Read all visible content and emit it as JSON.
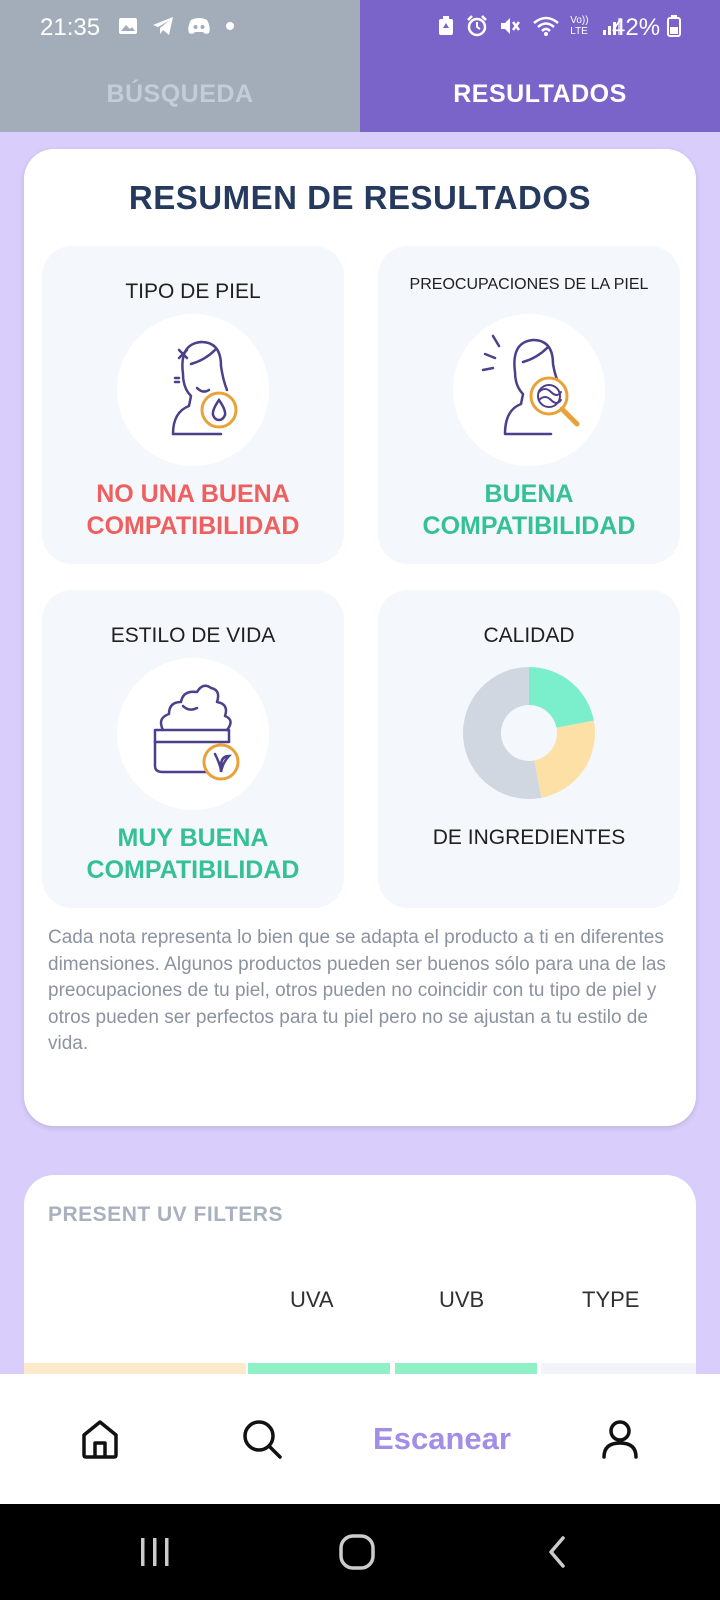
{
  "status_bar": {
    "time": "21:35",
    "battery": "42%",
    "left_icons": [
      "image-icon",
      "telegram-icon",
      "discord-icon",
      "dot-icon"
    ],
    "right_icons": [
      "battery-saver-icon",
      "alarm-icon",
      "mute-icon",
      "wifi-icon",
      "volte-icon",
      "signal-icon"
    ],
    "volte_label": "Vo)) LTE"
  },
  "tabs": [
    {
      "label": "BÚSQUEDA",
      "active": false
    },
    {
      "label": "RESULTADOS",
      "active": true
    }
  ],
  "summary": {
    "title": "RESUMEN DE RESULTADOS",
    "tiles": {
      "skin_type": {
        "title": "TIPO DE PIEL",
        "result_line1": "NO UNA BUENA",
        "result_line2": "COMPATIBILIDAD",
        "result_color": "#ee6060",
        "icon": "woman-water-drop-icon"
      },
      "skin_concerns": {
        "title": "PREOCUPACIONES DE LA PIEL",
        "result_line1": "BUENA",
        "result_line2": "COMPATIBILIDAD",
        "result_color": "#35c097",
        "icon": "woman-magnifier-icon"
      },
      "lifestyle": {
        "title": "ESTILO DE VIDA",
        "result_line1": "MUY BUENA",
        "result_line2": "COMPATIBILIDAD",
        "result_color": "#35c097",
        "icon": "cream-jar-vegan-icon"
      },
      "quality": {
        "title": "CALIDAD",
        "subtitle": "DE INGREDIENTES"
      }
    },
    "description": "Cada nota representa lo bien que se adapta el producto a ti en diferentes dimensiones. Algunos productos pueden ser buenos sólo para una de las preocupaciones de tu piel, otros pueden no coincidir con tu tipo de piel y otros pueden ser perfectos para tu piel pero no se ajustan a tu estilo de vida."
  },
  "chart_data": {
    "type": "pie",
    "title": "",
    "slices": [
      {
        "value": 0.22,
        "color": "#7befcc"
      },
      {
        "value": 0.25,
        "color": "#fde0a6"
      },
      {
        "value": 0.53,
        "color": "#d0d7e1"
      }
    ]
  },
  "uv_filters": {
    "title": "PRESENT UV FILTERS",
    "columns": [
      "UVA",
      "UVB",
      "TYPE"
    ],
    "row_colors": [
      "#fdeacd",
      "#90f0c6",
      "#90f0c6",
      "#f2f4f7"
    ]
  },
  "bottom_nav": {
    "items": [
      {
        "icon": "home-icon"
      },
      {
        "icon": "search-icon"
      },
      {
        "label": "Escanear"
      },
      {
        "icon": "user-icon"
      }
    ]
  },
  "system_nav": [
    "recents-icon",
    "home-circle-icon",
    "back-icon"
  ]
}
